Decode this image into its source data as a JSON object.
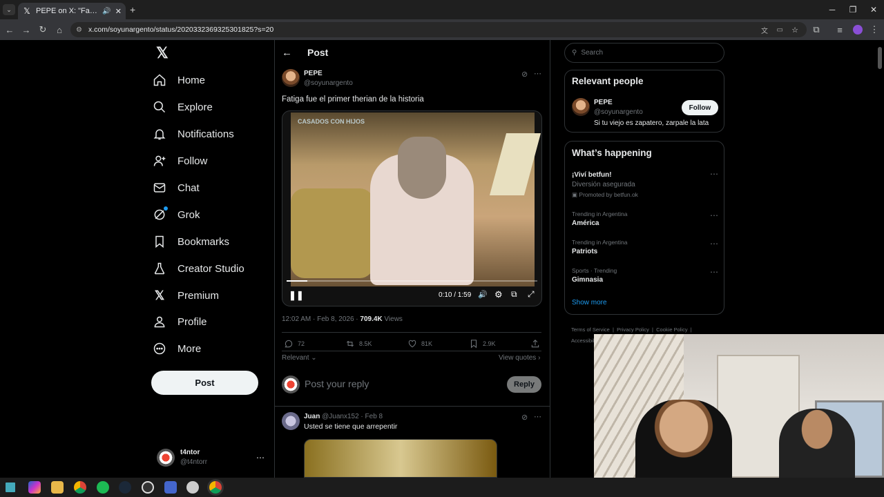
{
  "browser": {
    "tab_title": "PEPE on X: \"Fatiga fue el primer therian de la historia\"",
    "url": "x.com/soyunargento/status/2020332369325301825?s=20"
  },
  "sidebar": {
    "items": [
      {
        "label": "Home",
        "icon": "home-icon"
      },
      {
        "label": "Explore",
        "icon": "search-icon"
      },
      {
        "label": "Notifications",
        "icon": "bell-icon"
      },
      {
        "label": "Follow",
        "icon": "person-add-icon"
      },
      {
        "label": "Chat",
        "icon": "envelope-icon"
      },
      {
        "label": "Grok",
        "icon": "grok-icon"
      },
      {
        "label": "Bookmarks",
        "icon": "bookmark-icon"
      },
      {
        "label": "Creator Studio",
        "icon": "flask-icon"
      },
      {
        "label": "Premium",
        "icon": "x-logo-icon"
      },
      {
        "label": "Profile",
        "icon": "person-icon"
      },
      {
        "label": "More",
        "icon": "more-circle-icon"
      }
    ],
    "post_label": "Post",
    "account": {
      "name": "t4ntor",
      "handle": "@t4ntorr"
    }
  },
  "post": {
    "header_title": "Post",
    "author_name": "PEPE",
    "author_handle": "@soyunargento",
    "text": "Fatiga fue el primer therian de la historia",
    "video": {
      "watermark": "CASADOS CON HIJOS",
      "time": "0:10 / 1:59",
      "progress": 0.084
    },
    "timestamp": "12:02 AM · Feb 8, 2026 · ",
    "views_count": "709.4K",
    "views_label": " Views",
    "stats": {
      "replies": "72",
      "reposts": "8.5K",
      "likes": "81K",
      "bookmarks": "2.9K"
    },
    "sort_label": "Relevant",
    "view_quotes": "View quotes",
    "reply_placeholder": "Post your reply",
    "reply_button": "Reply"
  },
  "reply_item": {
    "name": "Juan",
    "meta": "@Juanx152 · Feb 8",
    "text": "Usted se tiene que arrepentir"
  },
  "right": {
    "search_placeholder": "Search",
    "relevant_title": "Relevant people",
    "person": {
      "name": "PEPE",
      "handle": "@soyunargento",
      "bio": "Si tu viejo es zapatero, zarpale la lata",
      "follow_label": "Follow"
    },
    "happening_title": "What’s happening",
    "trends": [
      {
        "top": "",
        "name": "¡Viví betfun!",
        "sub": "Diversión asegurada",
        "promo": "Promoted by betfun.ok"
      },
      {
        "top": "Trending in Argentina",
        "name": "América"
      },
      {
        "top": "Trending in Argentina",
        "name": "Patriots"
      },
      {
        "top": "Sports · Trending",
        "name": "Gimnasia"
      }
    ],
    "show_more": "Show more",
    "footer": [
      "Terms of Service",
      "Privacy Policy",
      "Cookie Policy",
      "Accessibility"
    ]
  },
  "colors": {
    "accent": "#1d9bf0",
    "bg": "#000000",
    "border": "#2f3336",
    "muted": "#71767b"
  }
}
